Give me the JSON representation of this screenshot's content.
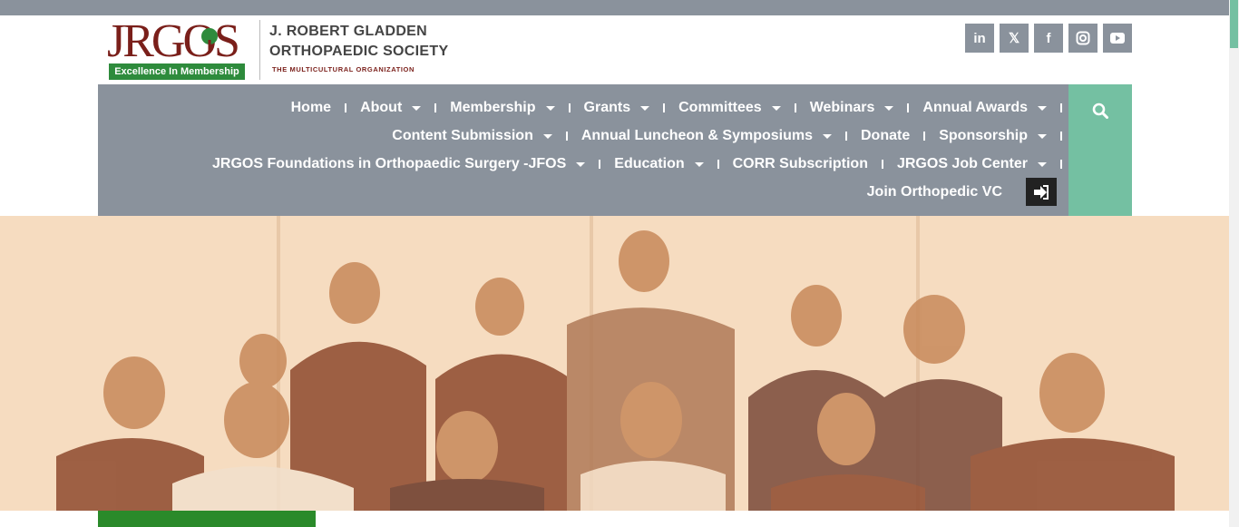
{
  "brand": {
    "logo_text": "JRGOS",
    "logo_tagline": "Excellence In Membership",
    "org_name_line1": "J. ROBERT GLADDEN",
    "org_name_line2": "ORTHOPAEDIC SOCIETY",
    "org_subtitle": "THE MULTICULTURAL ORGANIZATION",
    "colors": {
      "maroon": "#7a1f1a",
      "green": "#2e8b3c",
      "nav_gray": "#8a929c",
      "teal": "#74c0a2",
      "hero_tint": "#f6dcc0"
    }
  },
  "social": [
    {
      "name": "linkedin-icon",
      "glyph": "in"
    },
    {
      "name": "x-twitter-icon",
      "glyph": "𝕏"
    },
    {
      "name": "facebook-icon",
      "glyph": "f"
    },
    {
      "name": "instagram-icon",
      "glyph": "◙"
    },
    {
      "name": "youtube-icon",
      "glyph": "▶"
    }
  ],
  "nav": {
    "row1": [
      {
        "label": "Home",
        "dropdown": false
      },
      {
        "label": "About",
        "dropdown": true
      },
      {
        "label": "Membership",
        "dropdown": true
      },
      {
        "label": "Grants",
        "dropdown": true
      },
      {
        "label": "Committees",
        "dropdown": true
      },
      {
        "label": "Webinars",
        "dropdown": true
      },
      {
        "label": "Annual Awards",
        "dropdown": true
      }
    ],
    "row2": [
      {
        "label": "Content Submission",
        "dropdown": true
      },
      {
        "label": "Annual Luncheon & Symposiums",
        "dropdown": true
      },
      {
        "label": "Donate",
        "dropdown": false
      },
      {
        "label": "Sponsorship",
        "dropdown": true
      }
    ],
    "row3": [
      {
        "label": "JRGOS Foundations in Orthopaedic Surgery -JFOS",
        "dropdown": true
      },
      {
        "label": "Education",
        "dropdown": true
      },
      {
        "label": "CORR Subscription",
        "dropdown": false
      },
      {
        "label": "JRGOS Job Center",
        "dropdown": true
      }
    ],
    "row4": [
      {
        "label": "Join Orthopedic VC",
        "dropdown": false
      }
    ],
    "login_icon": "sign-in-icon",
    "search_icon": "search-icon"
  },
  "hero": {
    "image": "group-photo"
  }
}
